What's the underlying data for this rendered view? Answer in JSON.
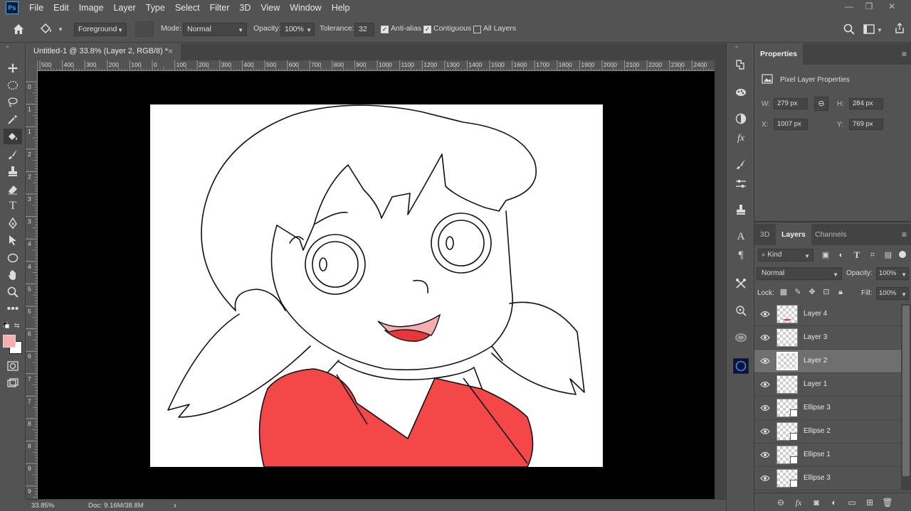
{
  "app": {
    "logo": "Ps"
  },
  "menu": [
    "File",
    "Edit",
    "Image",
    "Layer",
    "Type",
    "Select",
    "Filter",
    "3D",
    "View",
    "Window",
    "Help"
  ],
  "window_controls": {
    "minimize": "—",
    "restore": "❐",
    "close": "✕"
  },
  "options": {
    "fill_source": "Foreground",
    "mode_label": "Mode:",
    "mode_value": "Normal",
    "opacity_label": "Opacity:",
    "opacity_value": "100%",
    "tolerance_label": "Tolerance:",
    "tolerance_value": "32",
    "anti_alias_label": "Anti-alias",
    "anti_alias_checked": true,
    "contiguous_label": "Contiguous",
    "contiguous_checked": true,
    "all_layers_label": "All Layers",
    "all_layers_checked": false
  },
  "document_tab": {
    "title": "Untitled-1 @ 33.8% (Layer 2, RGB/8) *",
    "close": "×"
  },
  "ruler": {
    "horizontal_ticks": [
      "500",
      "400",
      "300",
      "200",
      "100",
      "0",
      "100",
      "200",
      "300",
      "400",
      "500",
      "600",
      "700",
      "800",
      "900",
      "1000",
      "1100",
      "1200",
      "1300",
      "1400",
      "1500",
      "1600",
      "1700",
      "1800",
      "1900",
      "2000",
      "2100",
      "2200",
      "2300",
      "2400"
    ],
    "vertical_ticks": [
      "0",
      "1",
      "1",
      "2",
      "2",
      "3",
      "3",
      "4",
      "4",
      "5",
      "5",
      "6",
      "6",
      "7",
      "7",
      "8",
      "8",
      "9",
      "9"
    ]
  },
  "status": {
    "zoom": "33.85%",
    "doc": "Doc: 9.16M/38.8M",
    "arrow": "›"
  },
  "colors": {
    "foreground": "#f4aeb0",
    "background": "#ffffff",
    "shirt": "#f44848",
    "mouth": "#e8363a",
    "tongue": "#f4aeb0"
  },
  "properties": {
    "tab": "Properties",
    "section": "Pixel Layer Properties",
    "w_label": "W:",
    "w_value": "279 px",
    "h_label": "H:",
    "h_value": "284 px",
    "x_label": "X:",
    "x_value": "1007 px",
    "y_label": "Y:",
    "y_value": "769 px"
  },
  "layers_panel": {
    "tabs": [
      "3D",
      "Layers",
      "Channels"
    ],
    "active_tab": "Layers",
    "filter_kind": "Kind",
    "blend_mode": "Normal",
    "opacity_label": "Opacity:",
    "opacity_value": "100%",
    "lock_label": "Lock:",
    "fill_label": "Fill:",
    "fill_value": "100%",
    "layers": [
      {
        "name": "Layer 4",
        "shape": false,
        "selected": false
      },
      {
        "name": "Layer 3",
        "shape": false,
        "selected": false
      },
      {
        "name": "Layer 2",
        "shape": false,
        "selected": true
      },
      {
        "name": "Layer 1",
        "shape": false,
        "selected": false
      },
      {
        "name": "Ellipse 3",
        "shape": true,
        "selected": false
      },
      {
        "name": "Ellipse 2",
        "shape": true,
        "selected": false
      },
      {
        "name": "Ellipse 1",
        "shape": true,
        "selected": false
      },
      {
        "name": "Ellipse 3",
        "shape": true,
        "selected": false
      }
    ]
  },
  "icons": {
    "home": "home-icon",
    "paint_bucket": "paint-bucket-icon",
    "search": "search-icon",
    "workspace": "workspace-icon",
    "share": "share-icon"
  }
}
